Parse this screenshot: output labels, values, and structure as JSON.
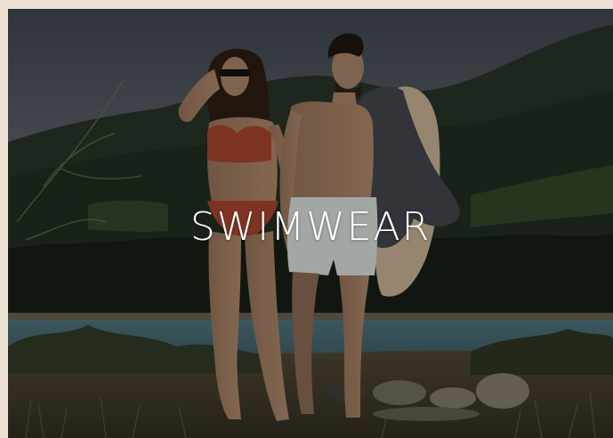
{
  "hero": {
    "title": "SWIMWEAR"
  },
  "colors": {
    "page_background": "#ece2d3",
    "title_text": "#ffffff"
  }
}
